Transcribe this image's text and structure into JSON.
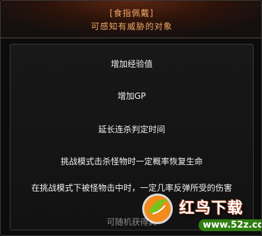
{
  "header": {
    "title": "[食指佩戴]",
    "subtitle": "可感知有威胁的对象"
  },
  "options": [
    {
      "label": "增加经验值"
    },
    {
      "label": "增加GP"
    },
    {
      "label": "延长连杀判定时间"
    },
    {
      "label": "挑战模式击杀怪物时一定概率恢复生命"
    },
    {
      "label": "在挑战模式下被怪物击中时，一定几率反弹所受的伤害"
    }
  ],
  "footer": {
    "text": "可随机获得其"
  },
  "watermark": {
    "brand": "红鸟下载",
    "url": "www.52z.com"
  },
  "colors": {
    "header_text": "#f0a868",
    "option_text": "#f2f2f2",
    "footer_text": "#8c8c8c"
  }
}
